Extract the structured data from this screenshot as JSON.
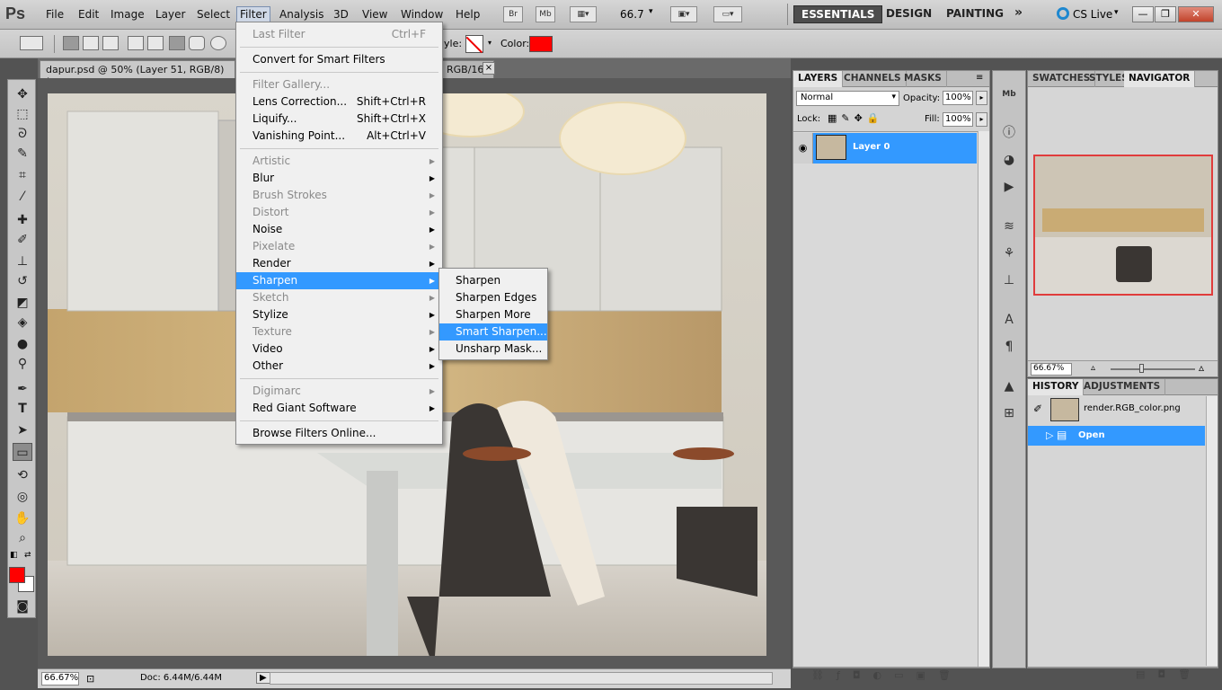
{
  "app": {
    "logo": "Ps"
  },
  "menubar": {
    "items": [
      "File",
      "Edit",
      "Image",
      "Layer",
      "Select",
      "Filter",
      "Analysis",
      "3D",
      "View",
      "Window",
      "Help"
    ],
    "bridge_btn": "Br",
    "minibridge_btn": "Mb",
    "zoom": "66.7",
    "workspaces": [
      "ESSENTIALS",
      "DESIGN",
      "PAINTING"
    ],
    "more": "»",
    "cslive": "CS Live"
  },
  "options": {
    "style_label": "yle:",
    "color_label": "Color:",
    "color": "#ff0000"
  },
  "doc": {
    "tab1": "dapur.psd @ 50% (Layer 51, RGB/8) *",
    "tab2_tail": "RGB/16)",
    "close": "×"
  },
  "filter_menu": {
    "items": [
      {
        "label": "Last Filter",
        "shortcut": "Ctrl+F",
        "disabled": true
      },
      {
        "sep": true
      },
      {
        "label": "Convert for Smart Filters"
      },
      {
        "sep": true
      },
      {
        "label": "Filter Gallery...",
        "disabled": true
      },
      {
        "label": "Lens Correction...",
        "shortcut": "Shift+Ctrl+R"
      },
      {
        "label": "Liquify...",
        "shortcut": "Shift+Ctrl+X"
      },
      {
        "label": "Vanishing Point...",
        "shortcut": "Alt+Ctrl+V"
      },
      {
        "sep": true
      },
      {
        "label": "Artistic",
        "disabled": true,
        "submenu": true
      },
      {
        "label": "Blur",
        "submenu": true
      },
      {
        "label": "Brush Strokes",
        "disabled": true,
        "submenu": true
      },
      {
        "label": "Distort",
        "disabled": true,
        "submenu": true
      },
      {
        "label": "Noise",
        "submenu": true
      },
      {
        "label": "Pixelate",
        "disabled": true,
        "submenu": true
      },
      {
        "label": "Render",
        "submenu": true
      },
      {
        "label": "Sharpen",
        "submenu": true,
        "highlighted": true
      },
      {
        "label": "Sketch",
        "disabled": true,
        "submenu": true
      },
      {
        "label": "Stylize",
        "submenu": true
      },
      {
        "label": "Texture",
        "disabled": true,
        "submenu": true
      },
      {
        "label": "Video",
        "submenu": true
      },
      {
        "label": "Other",
        "submenu": true
      },
      {
        "sep": true
      },
      {
        "label": "Digimarc",
        "disabled": true,
        "submenu": true
      },
      {
        "label": "Red Giant Software",
        "submenu": true
      },
      {
        "sep": true
      },
      {
        "label": "Browse Filters Online..."
      }
    ]
  },
  "sharpen_menu": {
    "items": [
      {
        "label": "Sharpen"
      },
      {
        "label": "Sharpen Edges"
      },
      {
        "label": "Sharpen More"
      },
      {
        "label": "Smart Sharpen...",
        "highlighted": true
      },
      {
        "label": "Unsharp Mask..."
      }
    ]
  },
  "layers_panel": {
    "tabs": [
      "LAYERS",
      "CHANNELS",
      "MASKS"
    ],
    "blend_mode": "Normal",
    "opacity_label": "Opacity:",
    "opacity": "100%",
    "lock_label": "Lock:",
    "fill_label": "Fill:",
    "fill": "100%",
    "layers": [
      {
        "name": "Layer 0"
      }
    ]
  },
  "navigator_panel": {
    "tabs": [
      "SWATCHES",
      "STYLES",
      "NAVIGATOR"
    ],
    "zoom": "66.67%"
  },
  "history_panel": {
    "tabs": [
      "HISTORY",
      "ADJUSTMENTS"
    ],
    "snapshot": "render.RGB_color.png",
    "states": [
      {
        "name": "Open"
      }
    ]
  },
  "status": {
    "zoom": "66.67%",
    "doc": "Doc: 6.44M/6.44M"
  },
  "colors": {
    "accent": "#3399ff",
    "foreground": "#ff0000",
    "background": "#ffffff"
  }
}
